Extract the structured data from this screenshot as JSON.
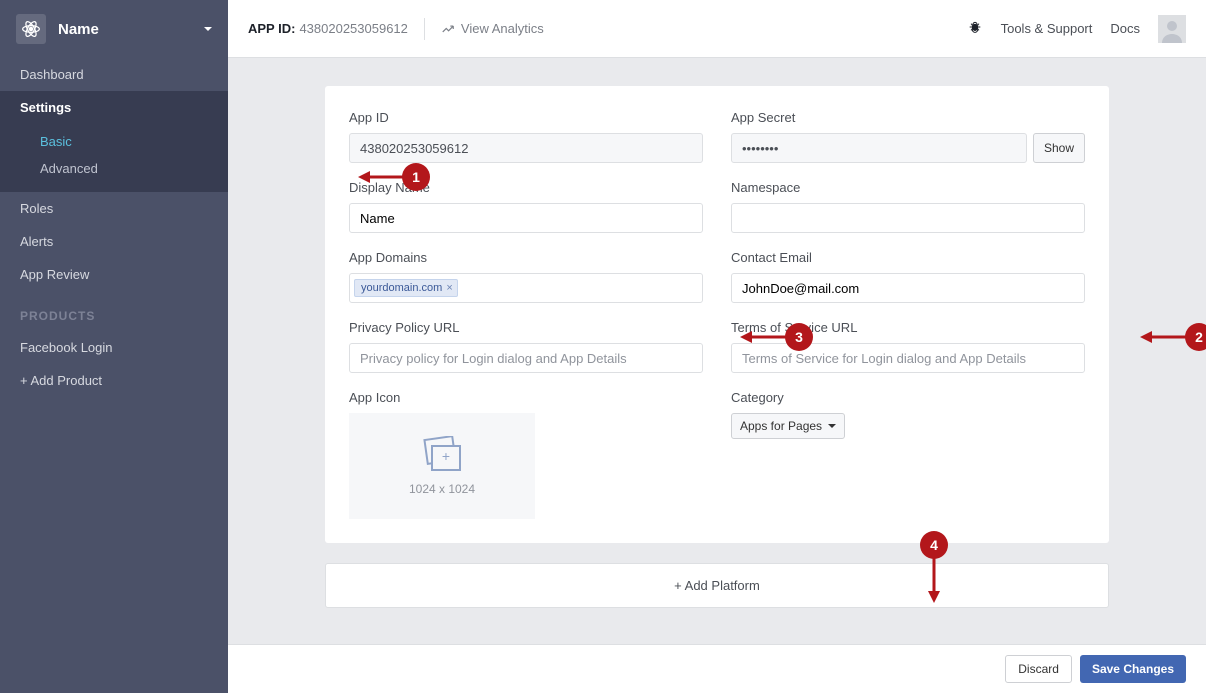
{
  "sidebar": {
    "app_name": "Name",
    "nav": {
      "dashboard": "Dashboard",
      "settings": "Settings",
      "basic": "Basic",
      "advanced": "Advanced",
      "roles": "Roles",
      "alerts": "Alerts",
      "app_review": "App Review"
    },
    "products_label": "PRODUCTS",
    "products": {
      "facebook_login": "Facebook Login",
      "add_product": "+ Add Product"
    }
  },
  "topbar": {
    "appid_label": "APP ID:",
    "appid_value": "438020253059612",
    "view_analytics": "View Analytics",
    "tools_support": "Tools & Support",
    "docs": "Docs"
  },
  "form": {
    "app_id_label": "App ID",
    "app_id_value": "438020253059612",
    "app_secret_label": "App Secret",
    "app_secret_value": "••••••••",
    "show_btn": "Show",
    "display_name_label": "Display Name",
    "display_name_value": "Name",
    "namespace_label": "Namespace",
    "namespace_value": "",
    "app_domains_label": "App Domains",
    "domain_tag": "yourdomain.com",
    "contact_email_label": "Contact Email",
    "contact_email_value": "JohnDoe@mail.com",
    "privacy_label": "Privacy Policy URL",
    "privacy_placeholder": "Privacy policy for Login dialog and App Details",
    "tos_label": "Terms of Service URL",
    "tos_placeholder": "Terms of Service for Login dialog and App Details",
    "app_icon_label": "App Icon",
    "icon_hint": "1024 x 1024",
    "category_label": "Category",
    "category_value": "Apps for Pages"
  },
  "add_platform": "+ Add Platform",
  "footer": {
    "discard": "Discard",
    "save": "Save Changes"
  },
  "annotations": {
    "n1": "1",
    "n2": "2",
    "n3": "3",
    "n4": "4"
  }
}
